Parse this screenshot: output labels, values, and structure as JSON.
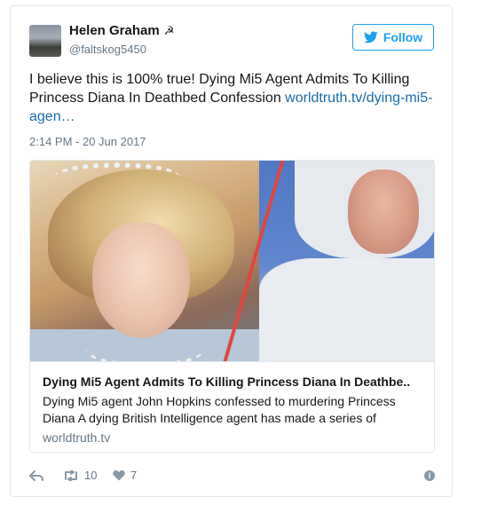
{
  "user": {
    "name": "Helen Graham",
    "emoji": "☭",
    "handle": "@faltskog5450"
  },
  "follow_label": "Follow",
  "tweet": {
    "text": "I believe this is 100% true! Dying Mi5 Agent Admits To Killing Princess Diana In Deathbed Confession",
    "link": "worldtruth.tv/dying-mi5-agen…",
    "timestamp": "2:14 PM - 20 Jun 2017"
  },
  "card": {
    "title": "Dying Mi5 Agent Admits To Killing Princess Diana In Deathbe..",
    "description": "Dying Mi5 agent John Hopkins confessed to murdering Princess Diana A dying British Intelligence agent has made a series of",
    "domain": "worldtruth.tv"
  },
  "actions": {
    "retweets": "10",
    "likes": "7"
  },
  "colors": {
    "accent": "#1da1f2",
    "link": "#1b6ca8",
    "muted": "#657786"
  }
}
